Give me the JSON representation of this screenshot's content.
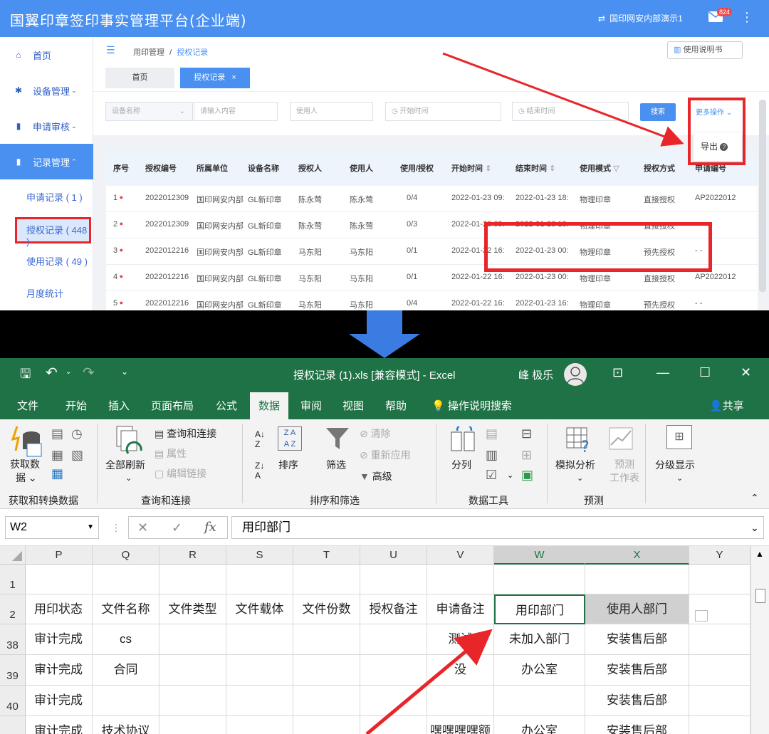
{
  "app": {
    "title": "国翼印章签印事实管理平台(企业端)",
    "org_switch": "国印网安内部演示1",
    "mail_badge": "824"
  },
  "sidebar": {
    "items": [
      {
        "label": "首页",
        "icon": "home-icon"
      },
      {
        "label": "设备管理",
        "icon": "gear-icon"
      },
      {
        "label": "申请审核",
        "icon": "document-icon"
      },
      {
        "label": "记录管理",
        "icon": "document-icon"
      }
    ],
    "subitems": [
      {
        "label": "申请记录 ( 1 )"
      },
      {
        "label": "授权记录 ( 448 )"
      },
      {
        "label": "使用记录 ( 49 )"
      },
      {
        "label": "月度统计"
      }
    ]
  },
  "breadcrumb": {
    "parent": "用印管理",
    "sep": "/",
    "current": "授权记录",
    "help": "使用说明书"
  },
  "tabs": {
    "home": "首页",
    "active": "授权记录",
    "close": "×"
  },
  "filters": {
    "device_select": "设备名称",
    "keyword_placeholder": "请输入内容",
    "user_placeholder": "使用人",
    "start_placeholder": "开始时间",
    "end_placeholder": "结束时间",
    "search": "搜索",
    "more": "更多操作",
    "export": "导出"
  },
  "table": {
    "headers": [
      "序号",
      "授权编号",
      "所属单位",
      "设备名称",
      "授权人",
      "使用人",
      "使用/授权",
      "开始时间",
      "结束时间",
      "使用模式",
      "授权方式",
      "申请编号"
    ],
    "rows": [
      [
        "1",
        "2022012309",
        "国印网安内部",
        "GL新印章",
        "陈永莺",
        "陈永莺",
        "0/4",
        "2022-01-23 09:",
        "2022-01-23 18:",
        "物理印章",
        "直接授权",
        "AP2022012"
      ],
      [
        "2",
        "2022012309",
        "国印网安内部",
        "GL新印章",
        "陈永莺",
        "陈永莺",
        "0/3",
        "2022-01-23 09:",
        "2022-01-23 18:",
        "物理印章",
        "直接授权",
        "- -"
      ],
      [
        "3",
        "2022012216",
        "国印网安内部",
        "GL新印章",
        "马东阳",
        "马东阳",
        "0/1",
        "2022-01-22 16:",
        "2022-01-23 00:",
        "物理印章",
        "预先授权",
        "- -"
      ],
      [
        "4",
        "2022012216",
        "国印网安内部",
        "GL新印章",
        "马东阳",
        "马东阳",
        "0/1",
        "2022-01-22 16:",
        "2022-01-23 00:",
        "物理印章",
        "直接授权",
        "AP2022012"
      ],
      [
        "5",
        "2022012216",
        "国印网安内部",
        "GL新印章",
        "马东阳",
        "马东阳",
        "0/4",
        "2022-01-22 16:",
        "2022-01-23 16:",
        "物理印章",
        "预先授权",
        "- -"
      ]
    ]
  },
  "excel": {
    "title": "授权记录 (1).xls  [兼容模式]  -  Excel",
    "user": "峰 极乐",
    "menu": [
      "文件",
      "开始",
      "插入",
      "页面布局",
      "公式",
      "数据",
      "审阅",
      "视图",
      "帮助",
      "操作说明搜索",
      "共享"
    ],
    "ribbon": {
      "get_data": "获取数据",
      "get_data_1": "获取数",
      "get_data_2": "据",
      "refresh_all": "全部刷新",
      "queries": "查询和连接",
      "properties": "属性",
      "edit_links": "编辑链接",
      "sort": "排序",
      "filter": "筛选",
      "clear": "清除",
      "reapply": "重新应用",
      "advanced": "高级",
      "text_to_cols": "分列",
      "whatif": "模拟分析",
      "forecast_1": "预测",
      "forecast_2": "工作表",
      "outline": "分级显示",
      "groups": [
        "获取和转换数据",
        "查询和连接",
        "排序和筛选",
        "数据工具",
        "预测"
      ]
    },
    "namebox": "W2",
    "fx": "fx",
    "formula": "用印部门",
    "columns": [
      "P",
      "Q",
      "R",
      "S",
      "T",
      "U",
      "V",
      "W",
      "X",
      "Y"
    ],
    "row_numbers": [
      "1",
      "2",
      "38",
      "39",
      "40"
    ],
    "header_row": [
      "用印状态",
      "文件名称",
      "文件类型",
      "文件载体",
      "文件份数",
      "授权备注",
      "申请备注",
      "用印部门",
      "使用人部门"
    ],
    "rows": [
      [
        "审计完成",
        "cs",
        "",
        "",
        "",
        "",
        "测试",
        "未加入部门",
        "安装售后部"
      ],
      [
        "审计完成",
        "合同",
        "",
        "",
        "",
        "",
        "没",
        "办公室",
        "安装售后部"
      ],
      [
        "审计完成",
        "",
        "",
        "",
        "",
        "",
        "",
        "",
        "安装售后部"
      ],
      [
        "审计完成",
        "技术协议",
        "",
        "",
        "",
        "",
        "嘿嘿嘿嘿额",
        "办公室",
        "安装售后部"
      ]
    ]
  },
  "colors": {
    "app_blue": "#4a90f0",
    "excel_green": "#1f7245",
    "highlight_red": "#e8262a"
  }
}
